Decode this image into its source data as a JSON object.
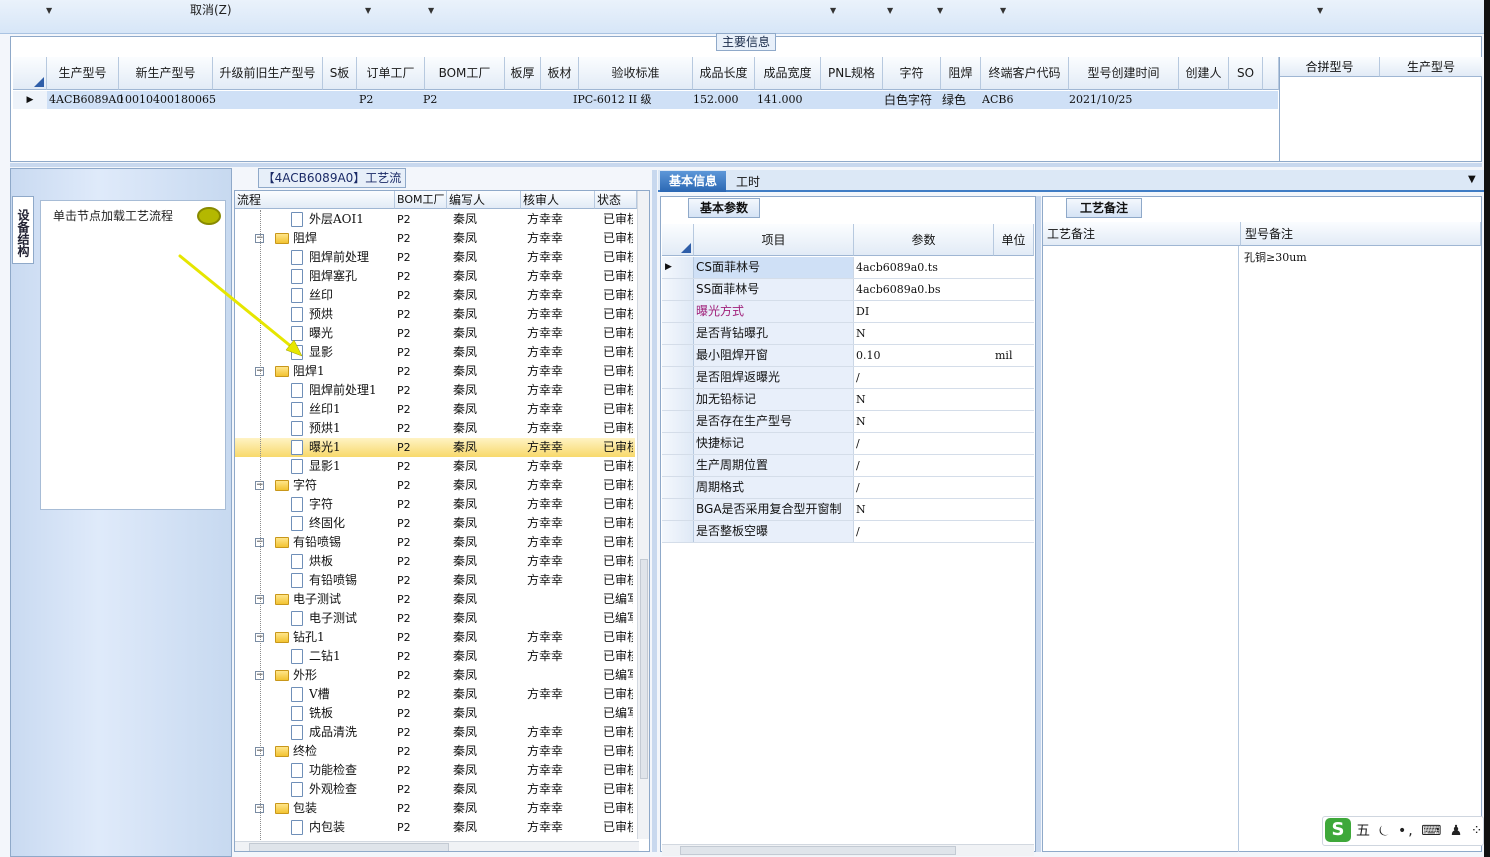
{
  "toolbar": {
    "cancel_label": "取消(Z)"
  },
  "main_info": {
    "title": "主要信息",
    "columns": [
      "生产型号",
      "新生产型号",
      "升级前旧生产型号",
      "S板",
      "订单工厂",
      "BOM工厂",
      "板厚",
      "板材",
      "验收标准",
      "成品长度",
      "成品宽度",
      "PNL规格",
      "字符",
      "阻焊",
      "终端客户代码",
      "型号创建时间",
      "创建人",
      "SO"
    ],
    "row": {
      "prod_model": "4ACB6089A0",
      "new_model": "10010400180065",
      "order_factory": "P2",
      "bom_factory": "P2",
      "standard": "IPC-6012 II 级",
      "length": "152.000",
      "width": "141.000",
      "char": "白色字符",
      "solder": "绿色",
      "customer_code": "ACB6",
      "created": "2021/10/25"
    },
    "side_columns": [
      "合拼型号",
      "生产型号"
    ]
  },
  "left": {
    "tab_label": "设备结构",
    "hint": "单击节点加载工艺流程"
  },
  "tree": {
    "title": "【4ACB6089A0】工艺流程",
    "columns": [
      "流程",
      "BOM工厂",
      "编写人",
      "核审人",
      "状态"
    ],
    "rows": [
      {
        "name": "外层AOI1",
        "bom": "P2",
        "writer": "秦凤",
        "reviewer": "方幸幸",
        "status": "已审核",
        "level": 2
      },
      {
        "name": "阻焊",
        "bom": "P2",
        "writer": "秦凤",
        "reviewer": "方幸幸",
        "status": "已审核",
        "level": 1
      },
      {
        "name": "阻焊前处理",
        "bom": "P2",
        "writer": "秦凤",
        "reviewer": "方幸幸",
        "status": "已审核",
        "level": 2
      },
      {
        "name": "阻焊塞孔",
        "bom": "P2",
        "writer": "秦凤",
        "reviewer": "方幸幸",
        "status": "已审核",
        "level": 2
      },
      {
        "name": "丝印",
        "bom": "P2",
        "writer": "秦凤",
        "reviewer": "方幸幸",
        "status": "已审核",
        "level": 2
      },
      {
        "name": "预烘",
        "bom": "P2",
        "writer": "秦凤",
        "reviewer": "方幸幸",
        "status": "已审核",
        "level": 2
      },
      {
        "name": "曝光",
        "bom": "P2",
        "writer": "秦凤",
        "reviewer": "方幸幸",
        "status": "已审核",
        "level": 2
      },
      {
        "name": "显影",
        "bom": "P2",
        "writer": "秦凤",
        "reviewer": "方幸幸",
        "status": "已审核",
        "level": 2
      },
      {
        "name": "阻焊1",
        "bom": "P2",
        "writer": "秦凤",
        "reviewer": "方幸幸",
        "status": "已审核",
        "level": 1
      },
      {
        "name": "阻焊前处理1",
        "bom": "P2",
        "writer": "秦凤",
        "reviewer": "方幸幸",
        "status": "已审核",
        "level": 2
      },
      {
        "name": "丝印1",
        "bom": "P2",
        "writer": "秦凤",
        "reviewer": "方幸幸",
        "status": "已审核",
        "level": 2
      },
      {
        "name": "预烘1",
        "bom": "P2",
        "writer": "秦凤",
        "reviewer": "方幸幸",
        "status": "已审核",
        "level": 2
      },
      {
        "name": "曝光1",
        "bom": "P2",
        "writer": "秦凤",
        "reviewer": "方幸幸",
        "status": "已审核",
        "level": 2
      },
      {
        "name": "显影1",
        "bom": "P2",
        "writer": "秦凤",
        "reviewer": "方幸幸",
        "status": "已审核",
        "level": 2
      },
      {
        "name": "字符",
        "bom": "P2",
        "writer": "秦凤",
        "reviewer": "方幸幸",
        "status": "已审核",
        "level": 1
      },
      {
        "name": "字符",
        "bom": "P2",
        "writer": "秦凤",
        "reviewer": "方幸幸",
        "status": "已审核",
        "level": 2
      },
      {
        "name": "终固化",
        "bom": "P2",
        "writer": "秦凤",
        "reviewer": "方幸幸",
        "status": "已审核",
        "level": 2
      },
      {
        "name": "有铅喷锡",
        "bom": "P2",
        "writer": "秦凤",
        "reviewer": "方幸幸",
        "status": "已审核",
        "level": 1
      },
      {
        "name": "烘板",
        "bom": "P2",
        "writer": "秦凤",
        "reviewer": "方幸幸",
        "status": "已审核",
        "level": 2
      },
      {
        "name": "有铅喷锡",
        "bom": "P2",
        "writer": "秦凤",
        "reviewer": "方幸幸",
        "status": "已审核",
        "level": 2
      },
      {
        "name": "电子测试",
        "bom": "P2",
        "writer": "秦凤",
        "reviewer": "",
        "status": "已编写",
        "level": 1
      },
      {
        "name": "电子测试",
        "bom": "P2",
        "writer": "秦凤",
        "reviewer": "",
        "status": "已编写",
        "level": 2
      },
      {
        "name": "钻孔1",
        "bom": "P2",
        "writer": "秦凤",
        "reviewer": "方幸幸",
        "status": "已审核",
        "level": 1
      },
      {
        "name": "二钻1",
        "bom": "P2",
        "writer": "秦凤",
        "reviewer": "方幸幸",
        "status": "已审核",
        "level": 2
      },
      {
        "name": "外形",
        "bom": "P2",
        "writer": "秦凤",
        "reviewer": "",
        "status": "已编写",
        "level": 1
      },
      {
        "name": "V槽",
        "bom": "P2",
        "writer": "秦凤",
        "reviewer": "方幸幸",
        "status": "已审核",
        "level": 2
      },
      {
        "name": "铣板",
        "bom": "P2",
        "writer": "秦凤",
        "reviewer": "",
        "status": "已编写",
        "level": 2
      },
      {
        "name": "成品清洗",
        "bom": "P2",
        "writer": "秦凤",
        "reviewer": "方幸幸",
        "status": "已审核",
        "level": 2
      },
      {
        "name": "终检",
        "bom": "P2",
        "writer": "秦凤",
        "reviewer": "方幸幸",
        "status": "已审核",
        "level": 1
      },
      {
        "name": "功能检查",
        "bom": "P2",
        "writer": "秦凤",
        "reviewer": "方幸幸",
        "status": "已审核",
        "level": 2
      },
      {
        "name": "外观检查",
        "bom": "P2",
        "writer": "秦凤",
        "reviewer": "方幸幸",
        "status": "已审核",
        "level": 2
      },
      {
        "name": "包装",
        "bom": "P2",
        "writer": "秦凤",
        "reviewer": "方幸幸",
        "status": "已审核",
        "level": 1
      },
      {
        "name": "内包装",
        "bom": "P2",
        "writer": "秦凤",
        "reviewer": "方幸幸",
        "status": "已审核",
        "level": 2
      }
    ],
    "selected_index": 12
  },
  "tabs": {
    "basic": "基本信息",
    "hours": "工时"
  },
  "params": {
    "title": "基本参数",
    "columns": [
      "项目",
      "参数",
      "单位"
    ],
    "rows": [
      {
        "item": "CS面菲林号",
        "value": "4acb6089a0.ts",
        "unit": "",
        "highlight": false
      },
      {
        "item": "SS面菲林号",
        "value": "4acb6089a0.bs",
        "unit": "",
        "highlight": false
      },
      {
        "item": "曝光方式",
        "value": "DI",
        "unit": "",
        "highlight": true
      },
      {
        "item": "是否背钻曝孔",
        "value": "N",
        "unit": "",
        "highlight": false
      },
      {
        "item": "最小阻焊开窗",
        "value": "0.10",
        "unit": "mil",
        "highlight": false
      },
      {
        "item": "是否阻焊返曝光",
        "value": "/",
        "unit": "",
        "highlight": false
      },
      {
        "item": "加无铅标记",
        "value": "N",
        "unit": "",
        "highlight": false
      },
      {
        "item": "是否存在生产型号",
        "value": "N",
        "unit": "",
        "highlight": false
      },
      {
        "item": "快捷标记",
        "value": "/",
        "unit": "",
        "highlight": false
      },
      {
        "item": "生产周期位置",
        "value": "/",
        "unit": "",
        "highlight": false
      },
      {
        "item": "周期格式",
        "value": "/",
        "unit": "",
        "highlight": false
      },
      {
        "item": "BGA是否采用复合型开窗制作",
        "value": "N",
        "unit": "",
        "highlight": false
      },
      {
        "item": "是否整板空曝",
        "value": "/",
        "unit": "",
        "highlight": false
      }
    ]
  },
  "notes": {
    "title": "工艺备注",
    "columns": [
      "工艺备注",
      "型号备注"
    ],
    "model_note": "孔铜≥30um"
  },
  "ime": {
    "brand": "S",
    "text": "五 ⏾ •, ⌨ ♟ ⁘"
  },
  "colors": {
    "accent": "#2a67b3",
    "selected_row": "#f8d96b",
    "highlight_text": "#a0207a",
    "arrow": "#e6e600"
  }
}
